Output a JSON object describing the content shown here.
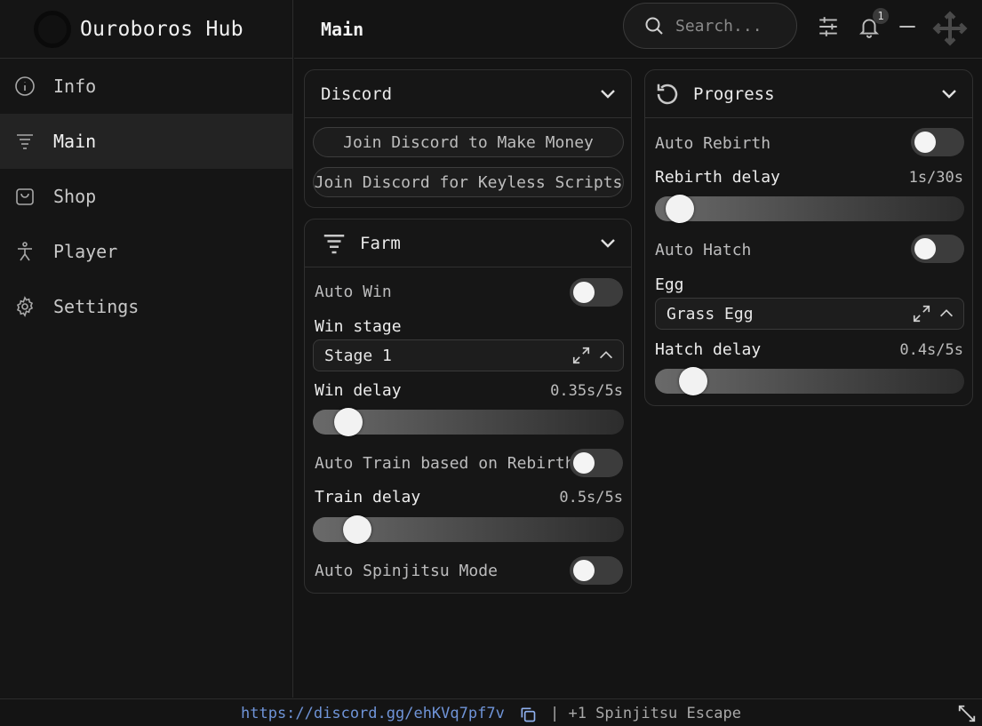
{
  "app": {
    "title": "Ouroboros Hub"
  },
  "sidebar": {
    "items": [
      {
        "label": "Info",
        "icon": "info-icon",
        "active": false
      },
      {
        "label": "Main",
        "icon": "list-filter-icon",
        "active": true
      },
      {
        "label": "Shop",
        "icon": "shopping-bag-icon",
        "active": false
      },
      {
        "label": "Player",
        "icon": "person-icon",
        "active": false
      },
      {
        "label": "Settings",
        "icon": "gear-icon",
        "active": false
      }
    ]
  },
  "header": {
    "title": "Main",
    "search_placeholder": "Search...",
    "notification_count": "1"
  },
  "discord": {
    "title": "Discord",
    "buttons": [
      "Join Discord to Make Money",
      "Join Discord for Keyless Scripts"
    ]
  },
  "farm": {
    "title": "Farm",
    "auto_win_label": "Auto Win",
    "auto_win_on": false,
    "win_stage_label": "Win stage",
    "win_stage_value": "Stage 1",
    "win_delay_label": "Win delay",
    "win_delay_value": "0.35s/5s",
    "win_delay_fraction": 0.07,
    "auto_train_label": "Auto Train based on Rebirth",
    "auto_train_on": false,
    "train_delay_label": "Train delay",
    "train_delay_value": "0.5s/5s",
    "train_delay_fraction": 0.1,
    "auto_spinjitsu_label": "Auto Spinjitsu Mode",
    "auto_spinjitsu_on": false
  },
  "progress": {
    "title": "Progress",
    "auto_rebirth_label": "Auto Rebirth",
    "auto_rebirth_on": false,
    "rebirth_delay_label": "Rebirth delay",
    "rebirth_delay_value": "1s/30s",
    "rebirth_delay_fraction": 0.033,
    "auto_hatch_label": "Auto Hatch",
    "auto_hatch_on": false,
    "egg_label": "Egg",
    "egg_value": "Grass Egg",
    "hatch_delay_label": "Hatch delay",
    "hatch_delay_value": "0.4s/5s",
    "hatch_delay_fraction": 0.08
  },
  "footer": {
    "link": "https://discord.gg/ehKVq7pf7v",
    "text": "| +1 Spinjitsu Escape"
  },
  "colors": {
    "background": "#141414",
    "panel": "#161616",
    "link": "#6f94d8"
  }
}
